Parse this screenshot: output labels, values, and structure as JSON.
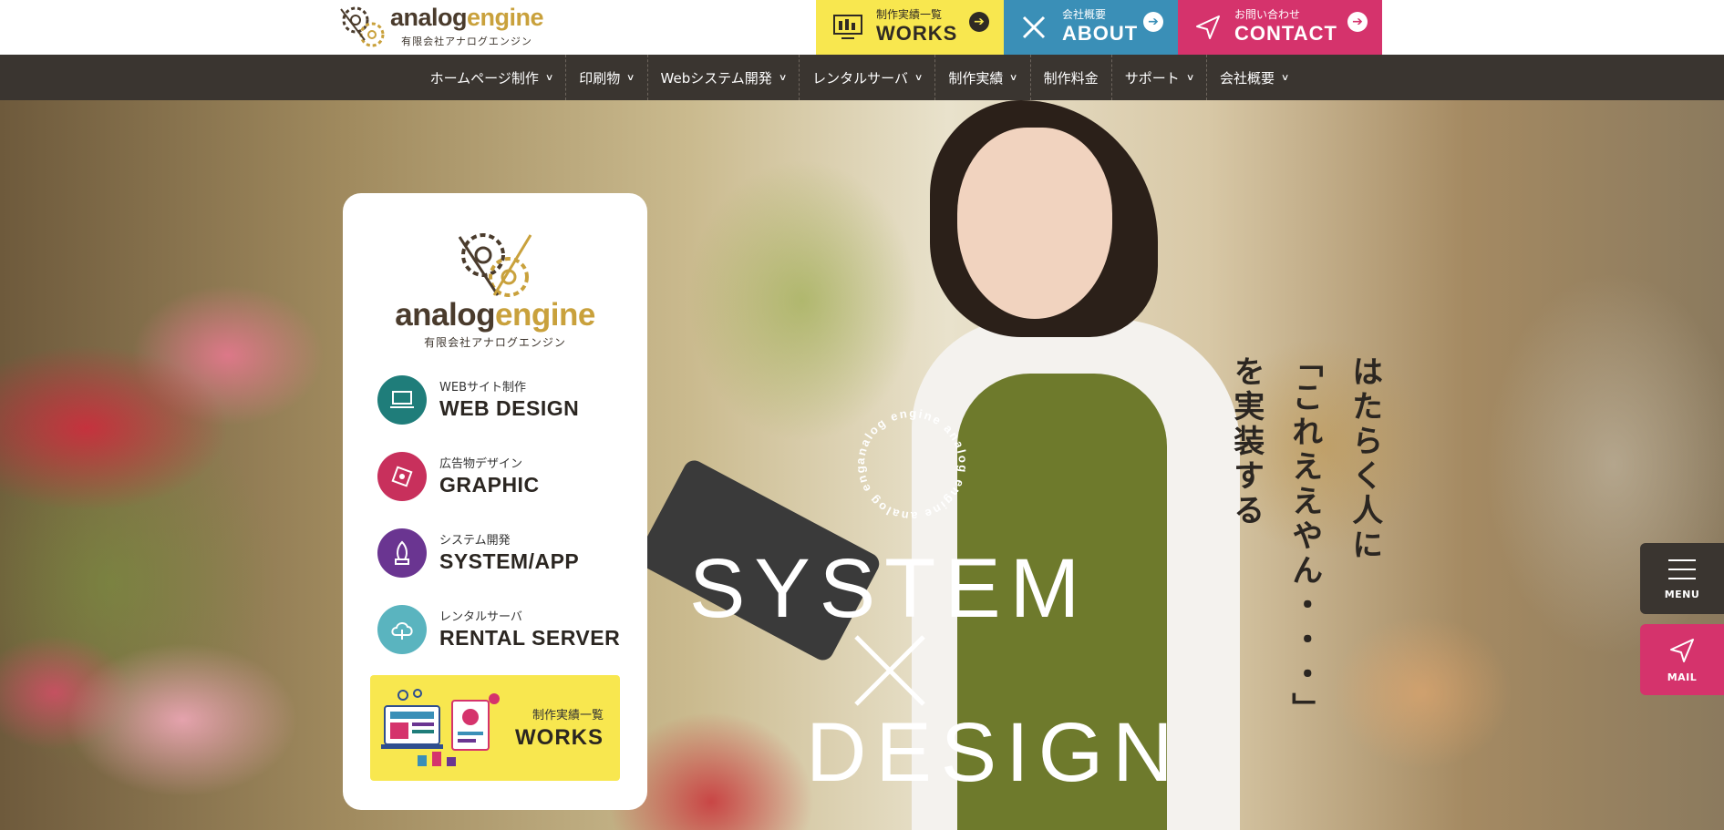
{
  "brand": {
    "word_a": "analog",
    "word_e": "engine",
    "subtitle": "有限会社アナログエンジン",
    "color_dark": "#4a3b2c",
    "color_gold": "#c9a13c"
  },
  "header_buttons": {
    "works": {
      "small": "制作実績一覧",
      "big": "WORKS",
      "icon": "monitor-icon",
      "color": "#f8e74f"
    },
    "about": {
      "small": "会社概要",
      "big": "ABOUT",
      "icon": "pencil-ruler-icon",
      "color": "#3a8fb7"
    },
    "contact": {
      "small": "お問い合わせ",
      "big": "CONTACT",
      "icon": "paper-plane-icon",
      "color": "#d5336c"
    }
  },
  "nav": {
    "items": [
      {
        "label": "ホームページ制作",
        "dropdown": true
      },
      {
        "label": "印刷物",
        "dropdown": true
      },
      {
        "label": "Webシステム開発",
        "dropdown": true
      },
      {
        "label": "レンタルサーバ",
        "dropdown": true
      },
      {
        "label": "制作実績",
        "dropdown": true
      },
      {
        "label": "制作料金",
        "dropdown": false
      },
      {
        "label": "サポート",
        "dropdown": true
      },
      {
        "label": "会社概要",
        "dropdown": true
      }
    ]
  },
  "services": [
    {
      "small": "WEBサイト制作",
      "big": "WEB DESIGN",
      "icon": "laptop-icon",
      "color": "#1f7d7a"
    },
    {
      "small": "広告物デザイン",
      "big": "GRAPHIC",
      "icon": "print-icon",
      "color": "#c8305c"
    },
    {
      "small": "システム開発",
      "big": "SYSTEM/APP",
      "icon": "rocket-icon",
      "color": "#6a3591"
    },
    {
      "small": "レンタルサーバ",
      "big": "RENTAL SERVER",
      "icon": "cloud-icon",
      "color": "#5ab4bf"
    }
  ],
  "works_box": {
    "small": "制作実績一覧",
    "big": "WORKS"
  },
  "hero": {
    "circle_text": "analog engine analog engine analog engine",
    "line1": "SYSTEM",
    "line2": "DESIGN",
    "tagline_1": "はたらく人に",
    "tagline_2": "「これええやん・・・」",
    "tagline_3": "を実装する"
  },
  "side": {
    "menu_label": "MENU",
    "mail_label": "MAIL"
  }
}
